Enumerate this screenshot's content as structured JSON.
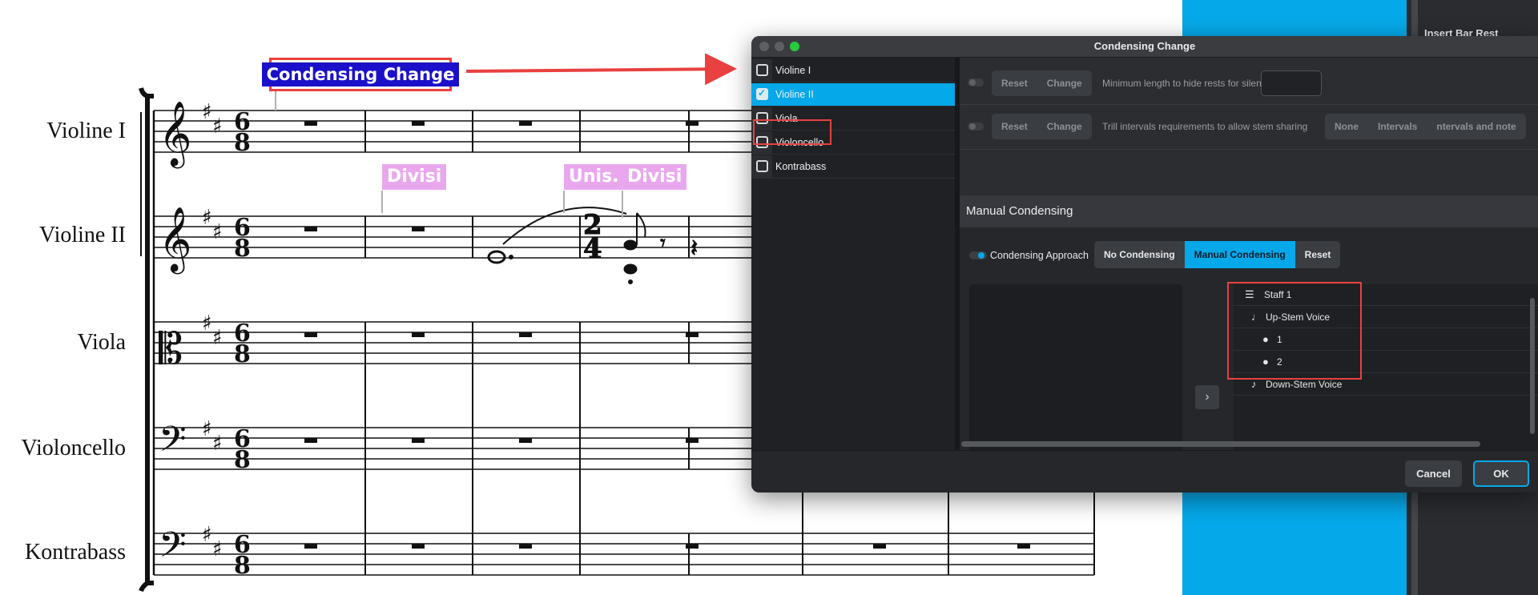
{
  "score": {
    "instruments": [
      "Violine  I",
      "Violine II",
      "Viola",
      "Violoncello",
      "Kontrabass"
    ],
    "labels": {
      "condensing_change": "Condensing Change",
      "divisi_1": "Divisi",
      "unis": "Unis.",
      "divisi_2": "Divisi"
    },
    "annotation_color": "#e8413f",
    "label_color": "#e9a8ee"
  },
  "background_panel": {
    "insert_bar_rest": "Insert Bar Rest"
  },
  "dialog": {
    "title": "Condensing Change",
    "players": [
      {
        "label": "Violine I",
        "checked": false
      },
      {
        "label": "Violine II",
        "checked": true
      },
      {
        "label": "Viola",
        "checked": false
      },
      {
        "label": "Violoncello",
        "checked": false
      },
      {
        "label": "Kontrabass",
        "checked": false
      }
    ],
    "option_rows": [
      {
        "reset": "Reset",
        "change": "Change",
        "text": "Minimum length to hide rests for silent players",
        "value": ""
      },
      {
        "reset": "Reset",
        "change": "Change",
        "text": "Trill intervals requirements to allow stem sharing",
        "choices": [
          "None",
          "Intervals",
          "ntervals and note"
        ]
      }
    ],
    "manual": {
      "title": "Manual Condensing",
      "approach_label": "Condensing Approach",
      "approach_options": [
        "No Condensing",
        "Manual Condensing",
        "Reset"
      ],
      "approach_selected": "Manual Condensing",
      "tree": [
        {
          "icon": "staff-icon",
          "label": "Staff 1"
        },
        {
          "icon": "note-up-icon",
          "label": "Up-Stem Voice"
        },
        {
          "icon": "player-icon",
          "label": "1"
        },
        {
          "icon": "player-icon",
          "label": "2"
        },
        {
          "icon": "note-down-icon",
          "label": "Down-Stem Voice"
        }
      ],
      "move_button": "›"
    },
    "footer": {
      "cancel": "Cancel",
      "ok": "OK"
    },
    "accent": "#05a8e8"
  }
}
